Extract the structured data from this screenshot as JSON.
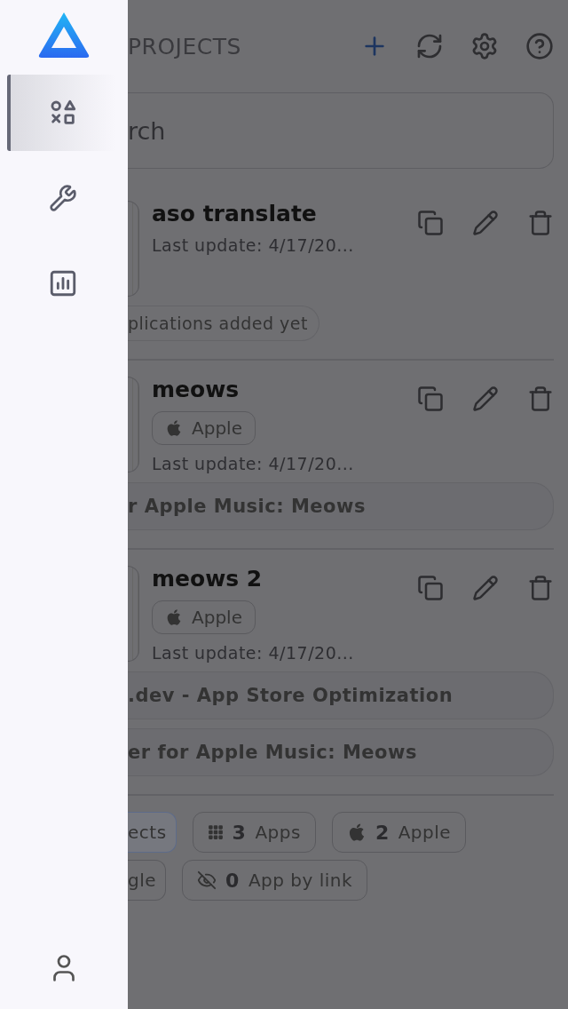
{
  "sidebar": {
    "items": [
      {
        "kind": "shapes",
        "selected": true
      },
      {
        "kind": "tools",
        "selected": false
      },
      {
        "kind": "chart",
        "selected": false
      }
    ]
  },
  "header": {
    "title": "PROJECTS"
  },
  "search": {
    "placeholder": "rch"
  },
  "projects": [
    {
      "title": "aso translate",
      "last_update": "Last update: 4/17/20...",
      "empty_note": "plications added yet"
    },
    {
      "title": "meows",
      "badge": "Apple",
      "last_update": "Last update: 4/17/20...",
      "apps": [
        "r Apple Music: Meows"
      ]
    },
    {
      "title": "meows 2",
      "badge": "Apple",
      "last_update": "Last update: 4/17/20...",
      "apps": [
        ".dev - App Store Optimization",
        "er for Apple Music: Meows"
      ]
    }
  ],
  "stats": [
    [
      {
        "kind": "plain",
        "label": "ects",
        "selected": true
      },
      {
        "kind": "grid",
        "count": "3",
        "label": "Apps",
        "selected": false
      },
      {
        "kind": "apple",
        "count": "2",
        "label": "Apple",
        "selected": false
      }
    ],
    [
      {
        "kind": "plain",
        "label": "gle",
        "selected": false
      },
      {
        "kind": "hidden",
        "count": "0",
        "label": "App by link",
        "selected": false
      }
    ]
  ]
}
